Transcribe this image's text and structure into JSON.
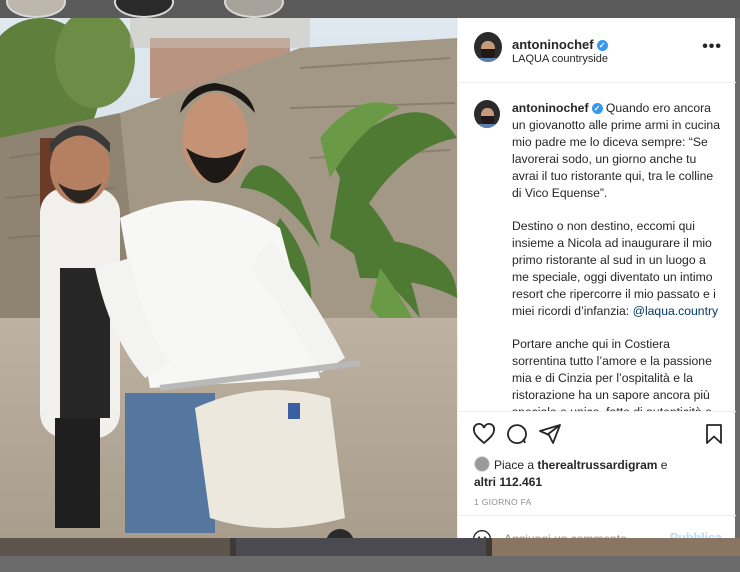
{
  "post": {
    "header": {
      "username": "antoninochef",
      "location": "LAQUA countryside",
      "more_label": "•••"
    },
    "caption": {
      "username": "antoninochef",
      "paragraph1": "Quando ero ancora un giovanotto alle prime armi in cucina mio padre me lo diceva sempre: “Se lavorerai sodo, un giorno anche tu avrai il tuo ristorante qui, tra le colline di Vico Equense”.",
      "paragraph2": "Destino o non destino, eccomi qui insieme a Nicola ad inaugurare il mio primo ristorante al sud in un luogo a me speciale, oggi diventato un intimo resort che ripercorre il mio passato e i miei ricordi d’infanzia: ",
      "paragraph2_link": "@laqua.country",
      "paragraph3": "Portare anche qui in Costiera sorrentina tutto l’amore e la passione mia e di Cinzia per l’ospitalità e la ristorazione ha un sapore ancora più speciale e unico, fatto di autenticità e"
    },
    "likes": {
      "prefix": "Piace a ",
      "user": "therealtrussardigram",
      "connector": " e",
      "others": "altri 112.461"
    },
    "timestamp": "1 GIORNO FA",
    "comment": {
      "placeholder": "Aggiungi un commento...",
      "publish_label": "Pubblica"
    },
    "icons": [
      "heart-icon",
      "comment-icon",
      "share-icon",
      "bookmark-icon",
      "emoji-icon",
      "verified-badge-icon"
    ]
  },
  "colors": {
    "accent_blue": "#3897f0",
    "link": "#00376b",
    "publish_disabled": "#b2dffc",
    "text": "#262626",
    "muted": "#8e8e8e"
  }
}
